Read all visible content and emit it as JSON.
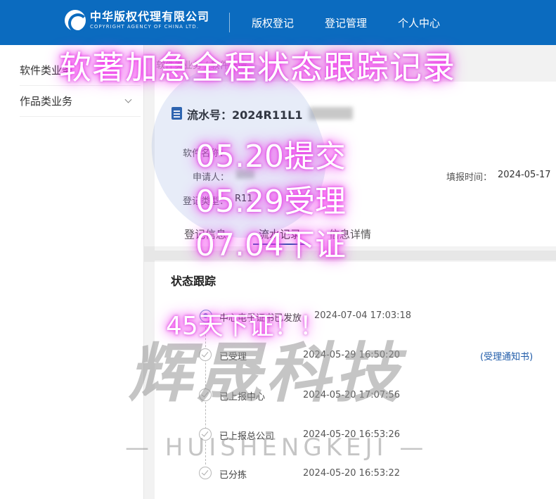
{
  "header": {
    "logo_cn": "中华版权代理有限公司",
    "logo_en": "COPYRIGHT AGENCY OF CHINA LTD.",
    "nav": [
      "版权登记",
      "登记管理",
      "个人中心"
    ]
  },
  "sidebar": {
    "items": [
      {
        "label": "软件类业务"
      },
      {
        "label": "作品类业务"
      }
    ]
  },
  "breadcrumb": "软件类业务 / 软件详情",
  "detail": {
    "serial_label": "流水号：2024R11L1",
    "software_name_label": "软件名称：",
    "applicant_label": "申请人：",
    "reg_type_label": "登记类型：",
    "reg_type_value": "R11",
    "fill_time_label": "填报时间：",
    "fill_time_value": "2024-05-17"
  },
  "tabs": [
    "登记信息",
    "流水记录",
    "信息详情"
  ],
  "status": {
    "title": "状态跟踪",
    "items": [
      {
        "status": "中心电子证书已发放",
        "time": "2024-07-04 17:03:18"
      },
      {
        "status": "已受理",
        "time": "2024-05-29 16:50:20",
        "link": "(受理通知书)"
      },
      {
        "status": "已上报中心",
        "time": "2024-05-20 17:07:56"
      },
      {
        "status": "已上报总公司",
        "time": "2024-05-20 16:53:26"
      },
      {
        "status": "已分拣",
        "time": "2024-05-20 16:53:22"
      }
    ]
  },
  "watermark": {
    "big": "辉晟科技",
    "small": "— HUISHENGKEJI —"
  },
  "overlay": {
    "title": "软著加急全程状态跟踪记录",
    "line1": "05.20提交",
    "line2": "05.29受理",
    "line3": "07.04下证",
    "line4": "45天下证！！"
  },
  "colors": {
    "header_bg": "#0b6bbf",
    "accent": "#1e5aa8",
    "overlay_glow": "#ff3cf0"
  }
}
